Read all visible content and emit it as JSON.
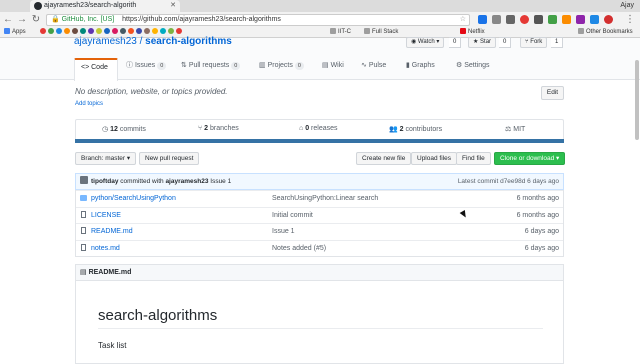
{
  "browser": {
    "tab_title": "ajayramesh23/search-algorith",
    "user_name": "Ajay",
    "secure_label": "GitHub, Inc. [US]",
    "url": "https://github.com/ajayramesh23/search-algorithms"
  },
  "bookmarks": {
    "items": [
      "Apps",
      "IIT-C",
      "Full Stack",
      "Netflix",
      "Other Bookmarks"
    ]
  },
  "repo": {
    "owner": "ajayramesh23",
    "separator": "/",
    "name": "search-algorithms",
    "watch_label": "Watch",
    "watch_count": "0",
    "star_label": "Star",
    "star_count": "0",
    "fork_label": "Fork",
    "fork_count": "1"
  },
  "tabs": {
    "code": "Code",
    "issues": "Issues",
    "issues_count": "0",
    "pull_requests": "Pull requests",
    "pull_requests_count": "0",
    "projects": "Projects",
    "projects_count": "0",
    "wiki": "Wiki",
    "pulse": "Pulse",
    "graphs": "Graphs",
    "settings": "Settings"
  },
  "about": {
    "description": "No description, website, or topics provided.",
    "add_topics": "Add topics",
    "edit_label": "Edit"
  },
  "summary": {
    "commits_num": "12",
    "commits_label": "commits",
    "branches_num": "2",
    "branches_label": "branches",
    "releases_num": "0",
    "releases_label": "releases",
    "contributors_num": "2",
    "contributors_label": "contributors",
    "license": "MIT"
  },
  "actions": {
    "branch_label": "Branch: master",
    "new_pull_request": "New pull request",
    "create_new_file": "Create new file",
    "upload_files": "Upload files",
    "find_file": "Find file",
    "clone_download": "Clone or download"
  },
  "commit_tease": {
    "author": "tipoftday",
    "middle": "committed with",
    "committer": "ajayramesh23",
    "message": "Issue 1",
    "latest": "Latest commit d7ee98d 6 days ago"
  },
  "files": [
    {
      "name": "python/SearchUsingPython",
      "message": "SearchUsingPython:Linear search",
      "age": "6 months ago"
    },
    {
      "name": "LICENSE",
      "message": "Initial commit",
      "age": "6 months ago"
    },
    {
      "name": "README.md",
      "message": "Issue 1",
      "age": "6 days ago"
    },
    {
      "name": "notes.md",
      "message": "Notes added (#5)",
      "age": "6 days ago"
    }
  ],
  "readme": {
    "header": "README.md",
    "title": "search-algorithms",
    "subtitle": "Task list"
  }
}
